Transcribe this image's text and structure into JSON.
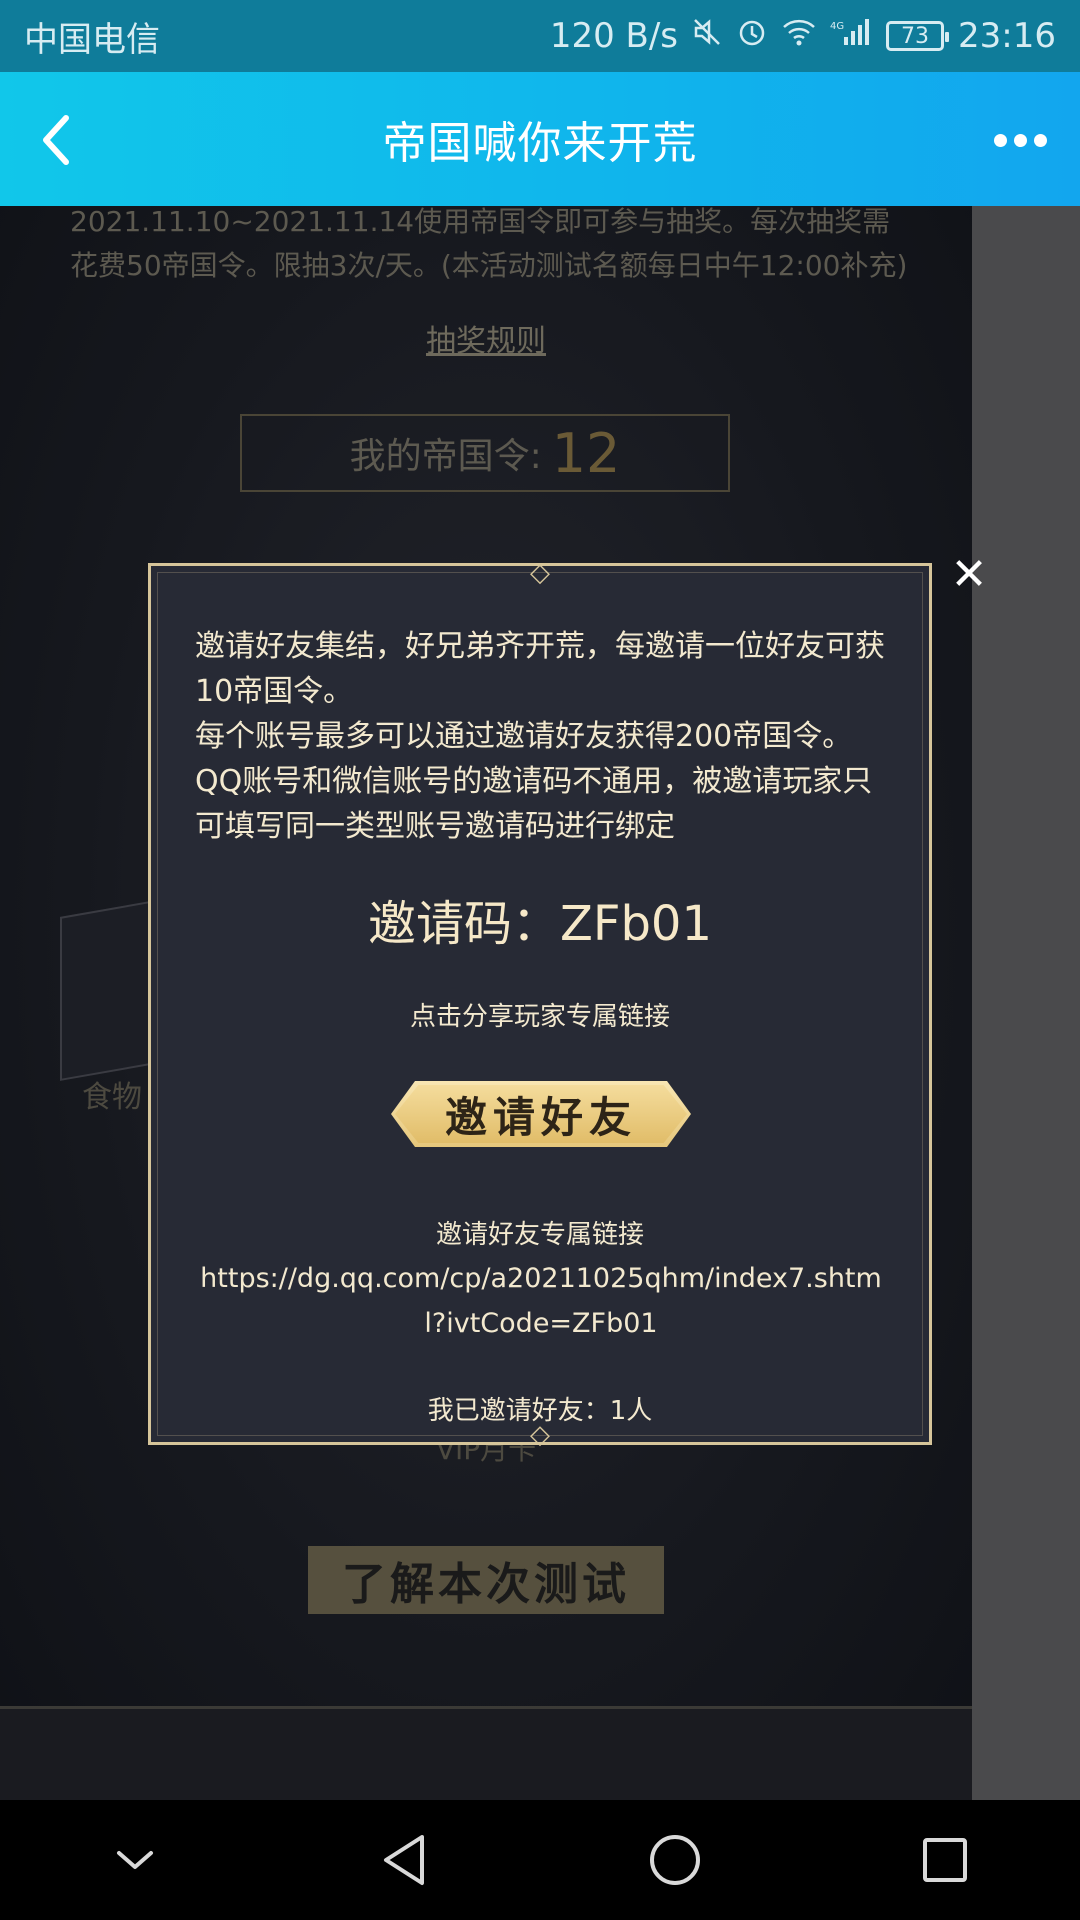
{
  "status_bar": {
    "carrier": "中国电信",
    "speed": "120 B/s",
    "battery": "73",
    "time": "23:16",
    "icons": [
      "mute-icon",
      "alarm-icon",
      "wifi-icon",
      "signal-4g-icon"
    ]
  },
  "header": {
    "title": "帝国喊你来开荒",
    "back_icon": "chevron-left-icon",
    "more_icon": "more-dots-icon"
  },
  "background_page": {
    "description": "2021.11.10~2021.11.14使用帝国令即可参与抽奖。每次抽奖需花费50帝国令。限抽3次/天。(本活动测试名额每日中午12:00补充)",
    "rules_link": "抽奖规则",
    "tokens_label": "我的帝国令:",
    "tokens_value": "12",
    "food_label": "食物",
    "vip_label": "VIP月卡",
    "test_button": "了解本次测试"
  },
  "modal": {
    "description": "邀请好友集结，好兄弟齐开荒，每邀请一位好友可获10帝国令。\n每个账号最多可以通过邀请好友获得200帝国令。\nQQ账号和微信账号的邀请码不通用，被邀请玩家只可填写同一类型账号邀请码进行绑定",
    "invite_code": "邀请码：ZFb01",
    "share_hint": "点击分享玩家专属链接",
    "invite_button": "邀请好友",
    "link_title": "邀请好友专属链接",
    "link_url": "https://dg.qq.com/cp/a20211025qhm/index7.shtml?ivtCode=ZFb01",
    "invited_count": "我已邀请好友：1人",
    "close_icon": "close-icon"
  },
  "nav_bar": {
    "icons": [
      "collapse-icon",
      "back-triangle-icon",
      "home-circle-icon",
      "recents-square-icon"
    ]
  },
  "colors": {
    "header_bg": "#11c7ea",
    "modal_bg": "#272a35",
    "modal_border": "#d6c59a",
    "gold_button": "#e6c77b"
  }
}
